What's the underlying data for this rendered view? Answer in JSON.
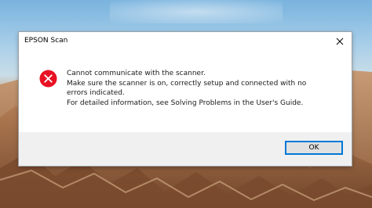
{
  "dialog": {
    "title": "EPSON Scan",
    "close_icon": "close-icon",
    "error_icon": "error-icon",
    "error_icon_color": "#e81123",
    "message_lines": [
      "Cannot communicate with the scanner.",
      "Make sure the scanner is on, correctly setup and connected with no",
      "errors indicated.",
      "For detailed information, see Solving Problems in the User's Guide."
    ],
    "ok_label": "OK",
    "accent_color": "#0078d7"
  }
}
